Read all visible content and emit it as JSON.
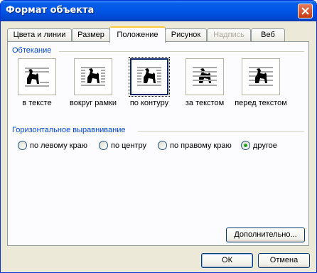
{
  "window": {
    "title": "Формат объекта"
  },
  "tabs": [
    {
      "label": "Цвета и линии",
      "state": "normal"
    },
    {
      "label": "Размер",
      "state": "normal"
    },
    {
      "label": "Положение",
      "state": "active"
    },
    {
      "label": "Рисунок",
      "state": "normal"
    },
    {
      "label": "Надпись",
      "state": "disabled"
    },
    {
      "label": "Веб",
      "state": "normal"
    }
  ],
  "wrapping": {
    "group_label": "Обтекание",
    "options": [
      {
        "label": "в тексте",
        "icon": "inline-with-text-icon"
      },
      {
        "label": "вокруг рамки",
        "icon": "square-wrap-icon"
      },
      {
        "label": "по контуру",
        "icon": "tight-wrap-icon",
        "selected": true
      },
      {
        "label": "за текстом",
        "icon": "behind-text-icon"
      },
      {
        "label": "перед текстом",
        "icon": "in-front-of-text-icon"
      }
    ]
  },
  "horizontal_alignment": {
    "group_label": "Горизонтальное выравнивание",
    "options": [
      {
        "label": "по левому краю",
        "checked": false
      },
      {
        "label": "по центру",
        "checked": false
      },
      {
        "label": "по правому краю",
        "checked": false
      },
      {
        "label": "другое",
        "checked": true
      }
    ]
  },
  "buttons": {
    "advanced": "Дополнительно...",
    "ok": "ОК",
    "cancel": "Отмена"
  }
}
